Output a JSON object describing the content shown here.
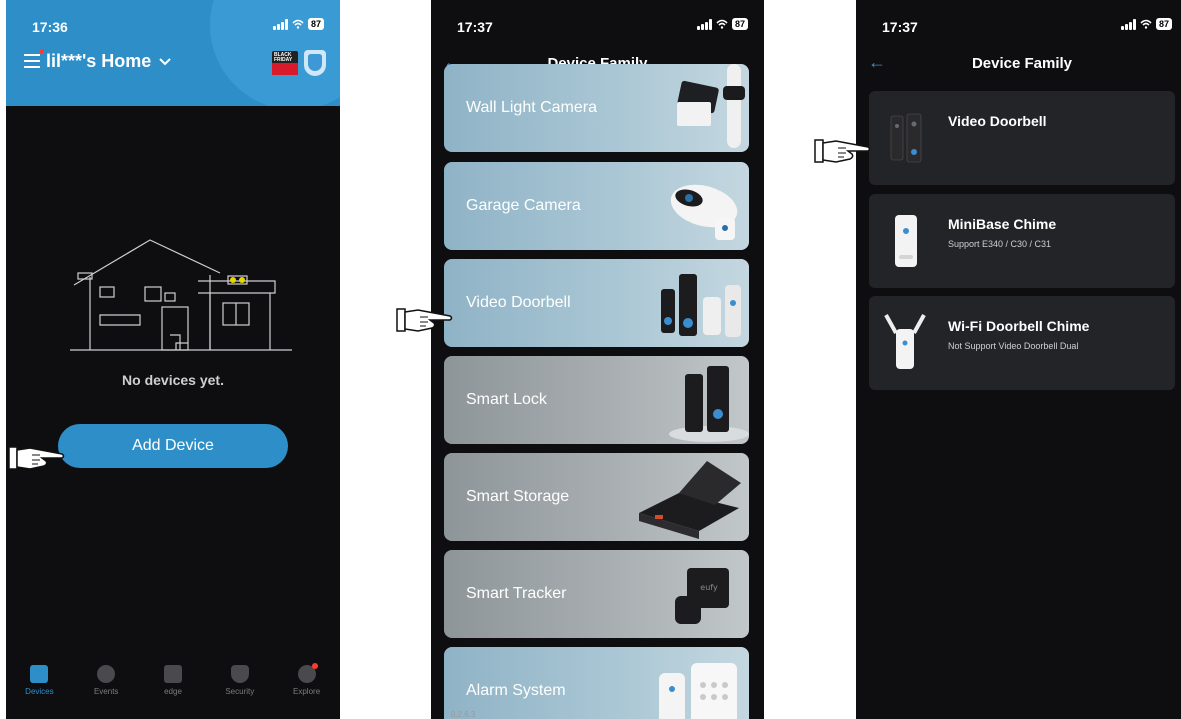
{
  "screen1": {
    "time": "17:36",
    "battery": "87",
    "home_title": "lil***'s Home",
    "promo_text": "BLACK FRIDAY",
    "empty_text": "No devices yet.",
    "add_button": "Add Device",
    "tabs": [
      {
        "label": "Devices",
        "icon": "house-icon"
      },
      {
        "label": "Events",
        "icon": "clock-icon"
      },
      {
        "label": "edge",
        "icon": "ai-chip-icon"
      },
      {
        "label": "Security",
        "icon": "shield-icon"
      },
      {
        "label": "Explore",
        "icon": "compass-icon"
      }
    ]
  },
  "screen2": {
    "time": "17:37",
    "battery": "87",
    "title": "Device Family",
    "categories": [
      "Wall Light Camera",
      "Garage Camera",
      "Video Doorbell",
      "Smart Lock",
      "Smart Storage",
      "Smart Tracker",
      "Alarm System"
    ],
    "build": "0.2.6.3"
  },
  "screen3": {
    "time": "17:37",
    "battery": "87",
    "title": "Device Family",
    "items": [
      {
        "name": "Video Doorbell",
        "subtitle": ""
      },
      {
        "name": "MiniBase Chime",
        "subtitle": "Support E340 / C30 / C31"
      },
      {
        "name": "Wi-Fi Doorbell Chime",
        "subtitle": "Not Support Video Doorbell Dual"
      }
    ]
  },
  "colors": {
    "accent": "#2e8fc8",
    "app_background": "#0e0e10",
    "list_item_background": "#232427",
    "back_arrow": "#3a8ed0"
  }
}
